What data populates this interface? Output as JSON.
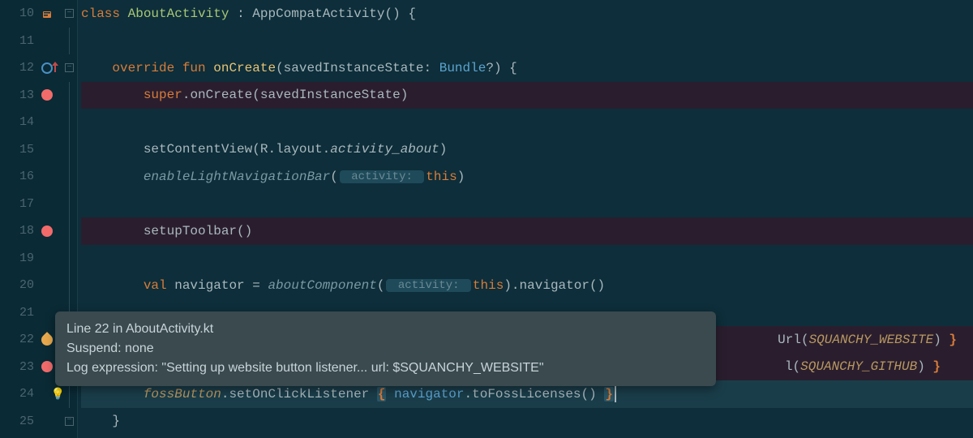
{
  "lines": [
    {
      "n": "10"
    },
    {
      "n": "11"
    },
    {
      "n": "12"
    },
    {
      "n": "13"
    },
    {
      "n": "14"
    },
    {
      "n": "15"
    },
    {
      "n": "16"
    },
    {
      "n": "17"
    },
    {
      "n": "18"
    },
    {
      "n": "19"
    },
    {
      "n": "20"
    },
    {
      "n": "21"
    },
    {
      "n": "22"
    },
    {
      "n": "23"
    },
    {
      "n": "24"
    },
    {
      "n": "25"
    }
  ],
  "code": {
    "l10": {
      "kw_class": "class",
      "cls": "AboutActivity",
      "col": ":",
      "type": "AppCompatActivity",
      "paren": "()",
      "brace": " {"
    },
    "l12": {
      "kw_override": "override",
      "kw_fun": "fun",
      "fn": "onCreate",
      "open": "(",
      "param": "savedInstanceState",
      "col": ":",
      "type": "Bundle",
      "q": "?",
      "close": ")",
      "brace": " {"
    },
    "l13": {
      "indent": "        ",
      "super": "super",
      "dot": ".",
      "call": "onCreate",
      "open": "(",
      "arg": "savedInstanceState",
      "close": ")"
    },
    "l15": {
      "indent": "        ",
      "call": "setContentView",
      "open": "(",
      "r": "R",
      "dot1": ".",
      "layout": "layout",
      "dot2": ".",
      "res": "activity_about",
      "close": ")"
    },
    "l16": {
      "indent": "        ",
      "call": "enableLightNavigationBar",
      "open": "(",
      "hint": " activity: ",
      "this": "this",
      "close": ")"
    },
    "l18": {
      "indent": "        ",
      "call": "setupToolbar",
      "paren": "()"
    },
    "l20": {
      "indent": "        ",
      "kw_val": "val",
      "name": " navigator = ",
      "call": "aboutComponent",
      "open": "(",
      "hint": " activity: ",
      "this": "this",
      "close": ")",
      "dot": ".",
      "nav": "navigator",
      "paren2": "()"
    },
    "l22": {
      "tail": "Url(",
      "const": "SQUANCHY_WEBSITE",
      "close": ") ",
      "brace": "}"
    },
    "l23": {
      "tail": "l(",
      "const": "SQUANCHY_GITHUB",
      "close": ") ",
      "brace": "}"
    },
    "l24": {
      "indent": "        ",
      "recv": "fossButton",
      "dot": ".",
      "call": "setOnClickListener ",
      "brace_open": "{",
      "nav": " navigator",
      "dot2": ".",
      "method": "toFossLicenses",
      "paren": "() ",
      "brace_close": "}"
    },
    "l25": {
      "indent": "    ",
      "brace": "}"
    }
  },
  "tooltip": {
    "line1": "Line 22 in AboutActivity.kt",
    "line2": "Suspend: none",
    "line3": "Log expression: \"Setting up website button listener... url: $SQUANCHY_WEBSITE\""
  }
}
